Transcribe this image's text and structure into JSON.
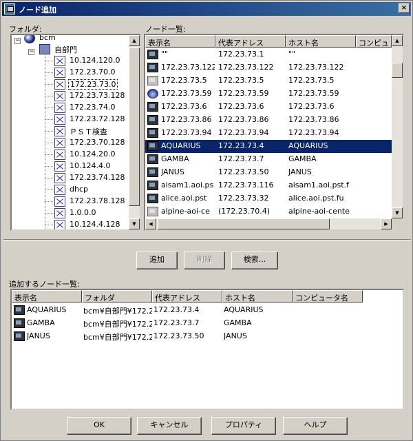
{
  "window": {
    "title": "ノード追加",
    "close_glyph": "×"
  },
  "folder_panel": {
    "label": "フォルダ:",
    "root_label": "bcm",
    "group_label": "自部門",
    "items": [
      "10.124.120.0",
      "172.23.70.0",
      "172.23.73.0",
      "172.23.73.128",
      "172.23.74.0",
      "172.23.72.128",
      "ＰＳＴ検査",
      "172.23.70.128",
      "10.124.20.0",
      "10.124.4.0",
      "172.23.74.128",
      "dhcp",
      "172.23.78.128",
      "1.0.0.0",
      "10.124.4.128"
    ],
    "selected_index": 2
  },
  "node_panel": {
    "label": "ノード一覧:",
    "columns": [
      "表示名",
      "代表アドレス",
      "ホスト名",
      "コンピュ"
    ],
    "rows": [
      {
        "icon": "monitor",
        "name": "\"\"",
        "addr": "172.23.73.1",
        "host": "\"\""
      },
      {
        "icon": "monitor",
        "name": "172.23.73.122",
        "addr": "172.23.73.122",
        "host": "172.23.73.122"
      },
      {
        "icon": "gray",
        "name": "172.23.73.5",
        "addr": "172.23.73.5",
        "host": "172.23.73.5"
      },
      {
        "icon": "globe",
        "name": "172.23.73.59",
        "addr": "172.23.73.59",
        "host": "172.23.73.59"
      },
      {
        "icon": "monitor",
        "name": "172.23.73.6",
        "addr": "172.23.73.6",
        "host": "172.23.73.6"
      },
      {
        "icon": "monitor",
        "name": "172.23.73.86",
        "addr": "172.23.73.86",
        "host": "172.23.73.86"
      },
      {
        "icon": "monitor",
        "name": "172.23.73.94",
        "addr": "172.23.73.94",
        "host": "172.23.73.94"
      },
      {
        "icon": "monitor",
        "name": "AQUARIUS",
        "addr": "172.23.73.4",
        "host": "AQUARIUS"
      },
      {
        "icon": "monitor",
        "name": "GAMBA",
        "addr": "172.23.73.7",
        "host": "GAMBA"
      },
      {
        "icon": "monitor",
        "name": "JANUS",
        "addr": "172.23.73.50",
        "host": "JANUS"
      },
      {
        "icon": "monitor",
        "name": "aisam1.aoi.ps",
        "addr": "172.23.73.116",
        "host": "aisam1.aoi.pst.f"
      },
      {
        "icon": "monitor",
        "name": "alice.aoi.pst",
        "addr": "172.23.73.32",
        "host": "alice.aoi.pst.fu"
      },
      {
        "icon": "gray",
        "name": "alpine-aoi-ce",
        "addr": "(172.23.70.4)",
        "host": "alpine-aoi-cente"
      }
    ],
    "selected_index": 7
  },
  "actions": {
    "add": "追加",
    "delete": "削除",
    "search": "検索..."
  },
  "added_panel": {
    "label": "追加するノード一覧:",
    "columns": [
      "表示名",
      "フォルダ",
      "代表アドレス",
      "ホスト名",
      "コンピュータ名"
    ],
    "rows": [
      {
        "name": "AQUARIUS",
        "folder": "bcm¥自部門¥172.2",
        "addr": "172.23.73.4",
        "host": "AQUARIUS"
      },
      {
        "name": "GAMBA",
        "folder": "bcm¥自部門¥172.2",
        "addr": "172.23.73.7",
        "host": "GAMBA"
      },
      {
        "name": "JANUS",
        "folder": "bcm¥自部門¥172.2",
        "addr": "172.23.73.50",
        "host": "JANUS"
      }
    ]
  },
  "footer": {
    "ok": "OK",
    "cancel": "キャンセル",
    "properties": "プロパティ",
    "help": "ヘルプ"
  },
  "scroll_glyphs": {
    "up": "▲",
    "down": "▼",
    "left": "◀",
    "right": "▶"
  },
  "colors": {
    "selection": "#0a246a",
    "titlebar": "#0a246a",
    "face": "#d4d0c8"
  }
}
